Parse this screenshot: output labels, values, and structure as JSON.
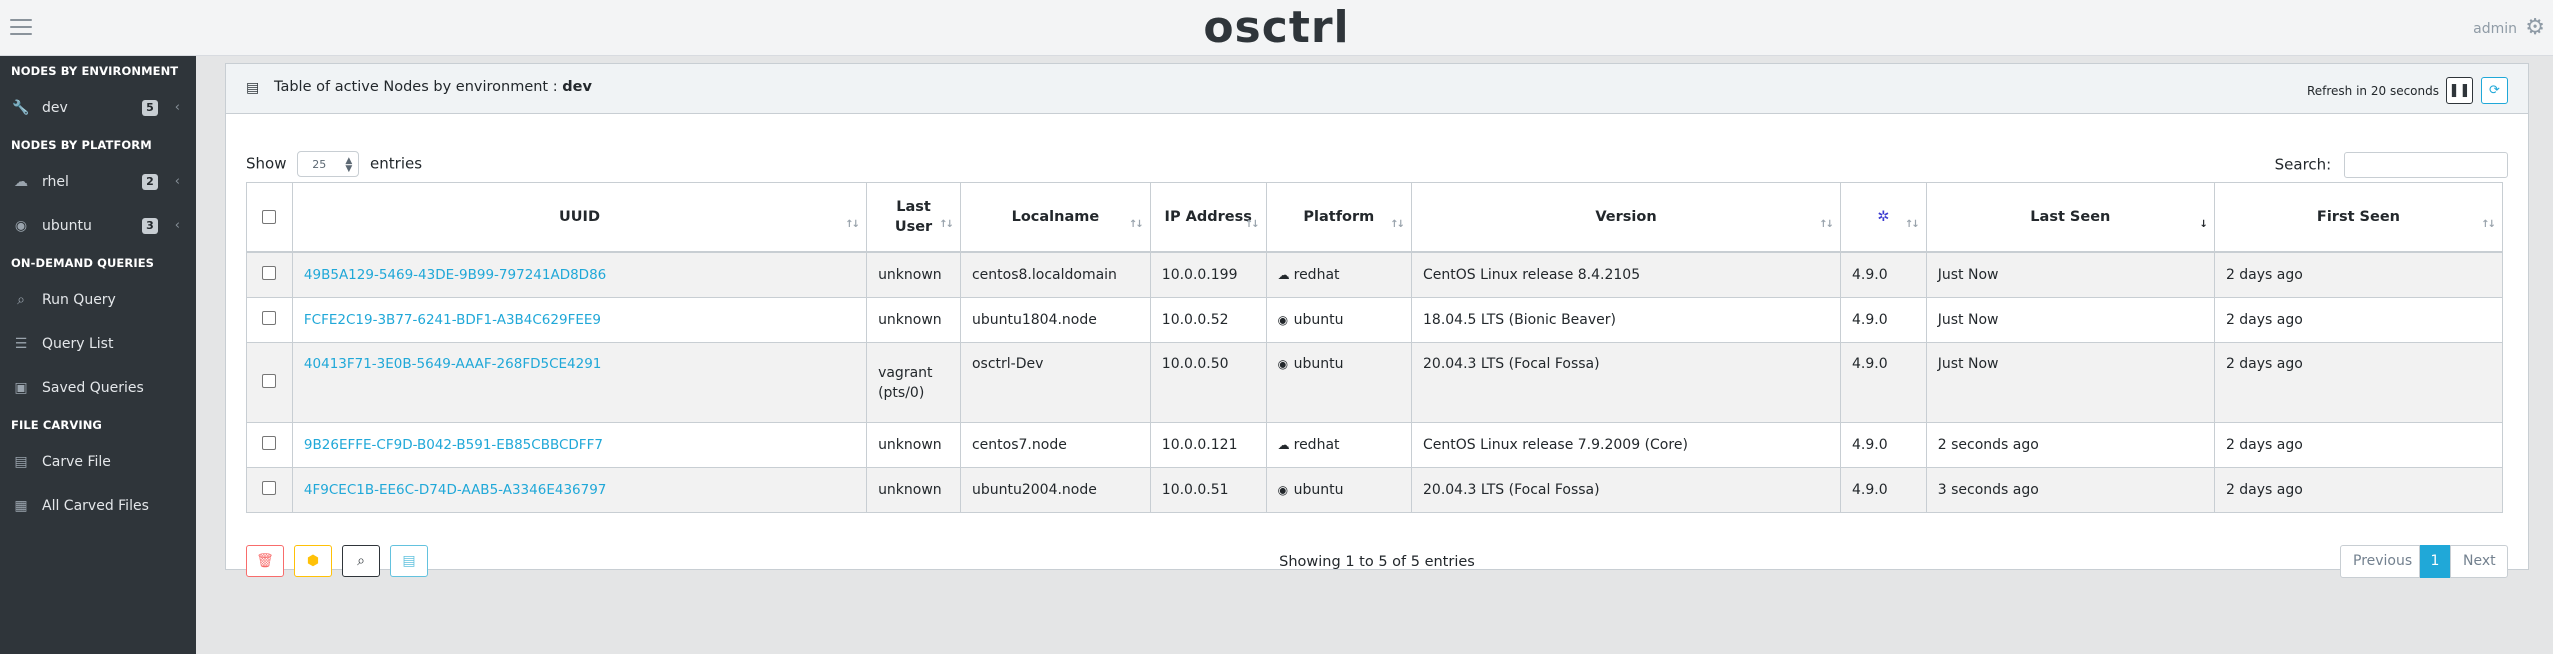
{
  "header": {
    "brand": "osctrl",
    "user": "admin"
  },
  "sidebar": {
    "sections": [
      {
        "title": "NODES BY ENVIRONMENT"
      },
      {
        "title": "NODES BY PLATFORM"
      },
      {
        "title": "ON-DEMAND QUERIES"
      },
      {
        "title": "FILE CARVING"
      }
    ],
    "items": [
      {
        "label": "dev",
        "badge": "5",
        "icon": "wrench-icon"
      },
      {
        "label": "rhel",
        "badge": "2",
        "icon": "redhat-icon"
      },
      {
        "label": "ubuntu",
        "badge": "3",
        "icon": "ubuntu-icon"
      },
      {
        "label": "Run Query",
        "icon": "search-icon"
      },
      {
        "label": "Query List",
        "icon": "list-icon"
      },
      {
        "label": "Saved Queries",
        "icon": "save-icon"
      },
      {
        "label": "Carve File",
        "icon": "file-icon"
      },
      {
        "label": "All Carved Files",
        "icon": "archive-icon"
      }
    ]
  },
  "panel": {
    "title_prefix": "Table of active Nodes by environment :",
    "title_env": "dev",
    "refresh_text": "Refresh in 20 seconds",
    "show_label": "Show",
    "show_value": "25",
    "entries_label": "entries",
    "search_label": "Search:",
    "search_value": ""
  },
  "table": {
    "columns": [
      "UUID",
      "Last User",
      "Localname",
      "IP Address",
      "Platform",
      "Version",
      "",
      "Last Seen",
      "First Seen"
    ],
    "osquery_col_icon": "osquery-icon",
    "rows": [
      {
        "uuid": "49B5A129-5469-43DE-9B99-797241AD8D86",
        "user": "unknown",
        "localname": "centos8.localdomain",
        "ip": "10.0.0.199",
        "platform": "redhat",
        "version": "CentOS Linux release 8.4.2105",
        "osquery": "4.9.0",
        "last_seen": "Just Now",
        "first_seen": "2 days ago"
      },
      {
        "uuid": "FCFE2C19-3B77-6241-BDF1-A3B4C629FEE9",
        "user": "unknown",
        "localname": "ubuntu1804.node",
        "ip": "10.0.0.52",
        "platform": "ubuntu",
        "version": "18.04.5 LTS (Bionic Beaver)",
        "osquery": "4.9.0",
        "last_seen": "Just Now",
        "first_seen": "2 days ago"
      },
      {
        "uuid": "40413F71-3E0B-5649-AAAF-268FD5CE4291",
        "user": "vagrant (pts/0)",
        "localname": "osctrl-Dev",
        "ip": "10.0.0.50",
        "platform": "ubuntu",
        "version": "20.04.3 LTS (Focal Fossa)",
        "osquery": "4.9.0",
        "last_seen": "Just Now",
        "first_seen": "2 days ago"
      },
      {
        "uuid": "9B26EFFE-CF9D-B042-B591-EB85CBBCDFF7",
        "user": "unknown",
        "localname": "centos7.node",
        "ip": "10.0.0.121",
        "platform": "redhat",
        "version": "CentOS Linux release 7.9.2009 (Core)",
        "osquery": "4.9.0",
        "last_seen": "2 seconds ago",
        "first_seen": "2 days ago"
      },
      {
        "uuid": "4F9CEC1B-EE6C-D74D-AAB5-A3346E436797",
        "user": "unknown",
        "localname": "ubuntu2004.node",
        "ip": "10.0.0.51",
        "platform": "ubuntu",
        "version": "20.04.3 LTS (Focal Fossa)",
        "osquery": "4.9.0",
        "last_seen": "3 seconds ago",
        "first_seen": "2 days ago"
      }
    ]
  },
  "footer": {
    "info": "Showing 1 to 5 of 5 entries",
    "prev": "Previous",
    "page": "1",
    "next": "Next"
  }
}
